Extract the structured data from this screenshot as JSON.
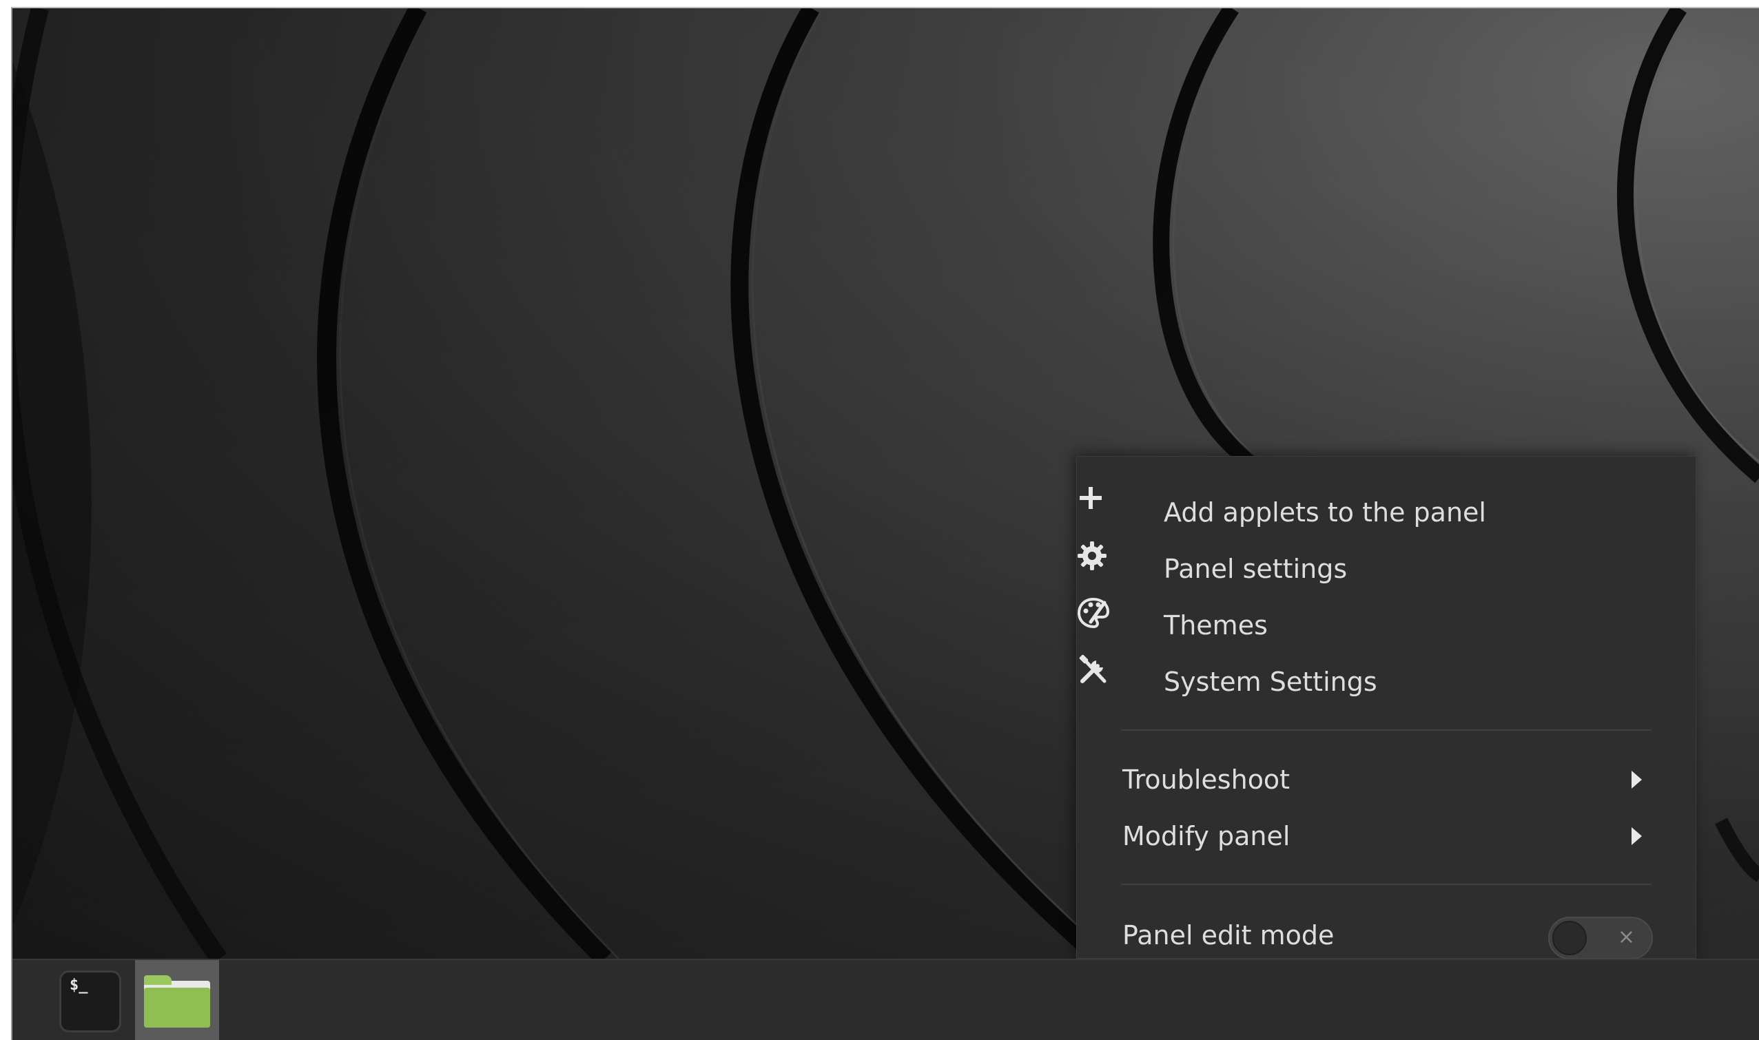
{
  "context_menu": {
    "items": [
      {
        "label": "Add applets to the panel",
        "icon": "plus-icon"
      },
      {
        "label": "Panel settings",
        "icon": "gear-icon"
      },
      {
        "label": "Themes",
        "icon": "palette-icon"
      },
      {
        "label": "System Settings",
        "icon": "tools-icon"
      }
    ],
    "submenus": [
      {
        "label": "Troubleshoot",
        "icon": "chevron-right-icon"
      },
      {
        "label": "Modify panel",
        "icon": "chevron-right-icon"
      }
    ],
    "edit_mode": {
      "label": "Panel edit mode",
      "state": "off",
      "toggle_glyph": "×"
    }
  },
  "taskbar": {
    "launchers": [
      {
        "name": "terminal",
        "icon": "terminal-icon",
        "glyph": "$_"
      },
      {
        "name": "files",
        "icon": "folder-icon",
        "active": true
      }
    ]
  },
  "colors": {
    "menu_bg": "#2e2e2e",
    "menu_text": "#dedede",
    "taskbar_bg": "#2c2c2c",
    "folder_green": "#8fbe52"
  }
}
